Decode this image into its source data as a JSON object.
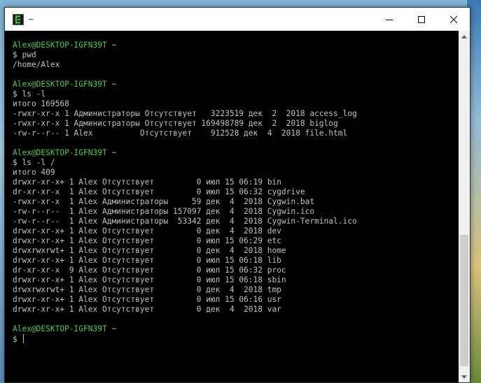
{
  "window": {
    "title": "~",
    "minimize_glyph": "—",
    "close_glyph": "✕"
  },
  "terminal": {
    "lines": [
      {
        "kind": "prompt",
        "user": "Alex@DESKTOP-IGFN39T",
        "path": "~"
      },
      {
        "kind": "text",
        "text": "$ pwd"
      },
      {
        "kind": "text",
        "text": "/home/Alex"
      },
      {
        "kind": "blank",
        "text": ""
      },
      {
        "kind": "prompt",
        "user": "Alex@DESKTOP-IGFN39T",
        "path": "~"
      },
      {
        "kind": "text",
        "text": "$ ls -l"
      },
      {
        "kind": "text",
        "text": "итого 169568"
      },
      {
        "kind": "text",
        "text": "-rwxr-xr-x 1 Администраторы Отсутствует   3223519 дек  2  2018 access_log"
      },
      {
        "kind": "text",
        "text": "-rwxr-xr-x 1 Администраторы Отсутствует 169498789 дек  2  2018 biglog"
      },
      {
        "kind": "text",
        "text": "-rw-r--r-- 1 Alex          Отсутствует    912528 дек  4  2018 file.html"
      },
      {
        "kind": "blank",
        "text": ""
      },
      {
        "kind": "prompt",
        "user": "Alex@DESKTOP-IGFN39T",
        "path": "~"
      },
      {
        "kind": "text",
        "text": "$ ls -l /"
      },
      {
        "kind": "text",
        "text": "итого 409"
      },
      {
        "kind": "text",
        "text": "drwxr-xr-x+ 1 Alex Отсутствует         0 июл 15 06:19 bin"
      },
      {
        "kind": "text",
        "text": "dr-xr-xr-x  1 Alex Отсутствует         0 июл 15 06:32 cygdrive"
      },
      {
        "kind": "text",
        "text": "-rwxr-xr-x  1 Alex Администраторы     59 дек  4  2018 Cygwin.bat"
      },
      {
        "kind": "text",
        "text": "-rw-r--r--  1 Alex Администраторы 157097 дек  4  2018 Cygwin.ico"
      },
      {
        "kind": "text",
        "text": "-rw-r--r--  1 Alex Администраторы  53342 дек  4  2018 Cygwin-Terminal.ico"
      },
      {
        "kind": "text",
        "text": "drwxr-xr-x+ 1 Alex Отсутствует         0 дек  4  2018 dev"
      },
      {
        "kind": "text",
        "text": "drwxr-xr-x+ 1 Alex Отсутствует         0 июл 15 06:29 etc"
      },
      {
        "kind": "text",
        "text": "drwxrwxrwt+ 1 Alex Отсутствует         0 дек  4  2018 home"
      },
      {
        "kind": "text",
        "text": "drwxr-xr-x+ 1 Alex Отсутствует         0 июл 15 06:18 lib"
      },
      {
        "kind": "text",
        "text": "dr-xr-xr-x  9 Alex Отсутствует         0 июл 15 06:32 proc"
      },
      {
        "kind": "text",
        "text": "drwxr-xr-x+ 1 Alex Отсутствует         0 июл 15 06:18 sbin"
      },
      {
        "kind": "text",
        "text": "drwxrwxrwt+ 1 Alex Отсутствует         0 дек  4  2018 tmp"
      },
      {
        "kind": "text",
        "text": "drwxr-xr-x+ 1 Alex Отсутствует         0 июл 15 06:16 usr"
      },
      {
        "kind": "text",
        "text": "drwxr-xr-x+ 1 Alex Отсутствует         0 дек  4  2018 var"
      },
      {
        "kind": "blank",
        "text": ""
      },
      {
        "kind": "prompt",
        "user": "Alex@DESKTOP-IGFN39T",
        "path": "~"
      },
      {
        "kind": "input",
        "text": "$ "
      }
    ]
  },
  "colors": {
    "prompt_user": "#4ec94e",
    "prompt_path": "#d4c23a",
    "output_text": "#c0c0c0",
    "background": "#000000"
  },
  "icons": {
    "app": "cygwin-terminal-icon",
    "minimize": "minimize-icon",
    "maximize": "maximize-icon",
    "close": "close-icon",
    "scroll_up": "chevron-up-icon",
    "scroll_down": "chevron-down-icon"
  }
}
